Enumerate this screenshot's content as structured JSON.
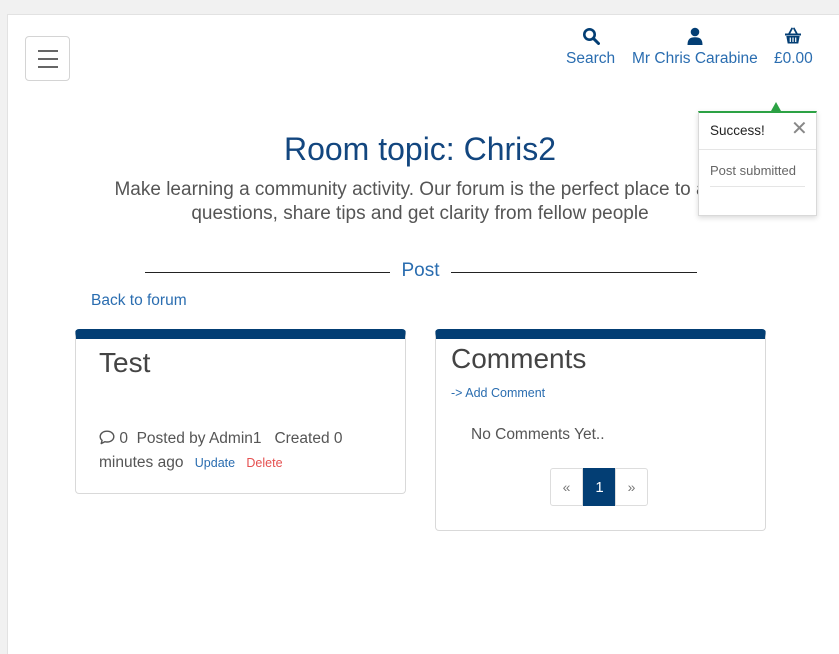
{
  "header": {
    "menu_icon": "hamburger-icon",
    "search": {
      "icon": "search-icon",
      "label": "Search"
    },
    "account": {
      "icon": "user-icon",
      "label": "Mr Chris Carabine"
    },
    "basket": {
      "icon": "basket-icon",
      "label": "£0.00"
    }
  },
  "page": {
    "title": "Room topic: Chris2",
    "subtitle": "Make learning a community activity. Our forum is the perfect place to ask questions, share tips and get clarity from fellow people",
    "section_label": "Post",
    "back_link": "Back to forum"
  },
  "post": {
    "title": "Test",
    "comment_icon": "comment-icon",
    "comment_count": "0",
    "posted_by": "Posted by Admin1",
    "created_label": "Created",
    "created_time": "0 minutes ago",
    "update_label": "Update",
    "delete_label": "Delete"
  },
  "comments": {
    "title": "Comments",
    "add_comment": "-> Add Comment",
    "empty_text": "No Comments Yet..",
    "pagination": {
      "prev": "«",
      "current": "1",
      "next": "»"
    }
  },
  "toast": {
    "title": "Success!",
    "close": "✕",
    "message": "Post submitted"
  },
  "colors": {
    "accent": "#033e74",
    "link": "#2a6db0",
    "title": "#12467f",
    "success": "#2ca244",
    "danger": "#e55050"
  }
}
